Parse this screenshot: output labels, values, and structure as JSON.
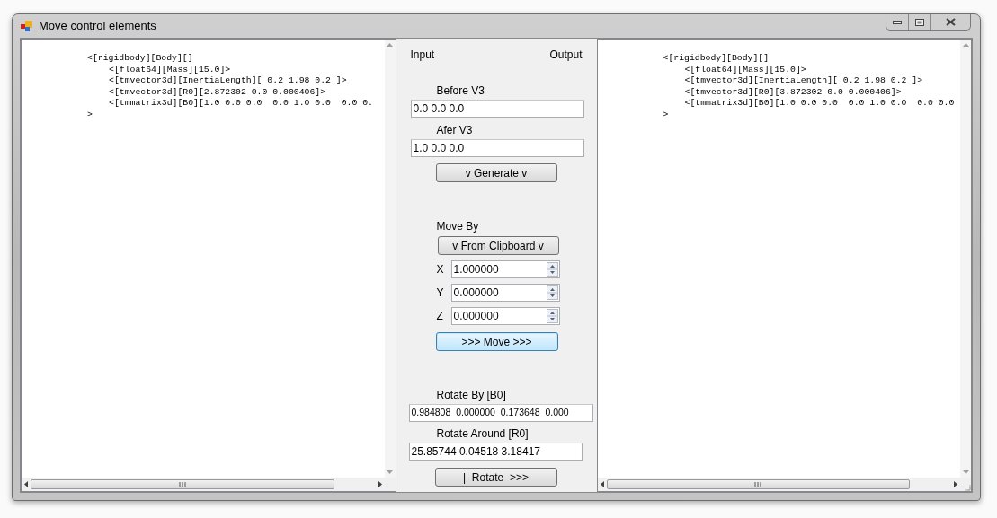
{
  "window": {
    "title": "Move control elements"
  },
  "input_pane": {
    "lines": [
      {
        "text": "<[rigidbody][Body][]",
        "children": [
          {
            "text": "<[float64][Mass][15.0]>"
          },
          {
            "text": "<[tmvector3d][InertiaLength][ 0.2 1.98 0.2 ]>"
          },
          {
            "text": "<[tmvector3d][R0][2.872302 0.0 0.000406]>"
          },
          {
            "text": "<[tmmatrix3d][B0][1.0 0.0 0.0  0.0 1.0 0.0  0.0 0."
          }
        ]
      },
      {
        "text": ">"
      }
    ]
  },
  "controls": {
    "input_label": "Input",
    "output_label": "Output",
    "before": {
      "label": "Before V3",
      "value": "0.0 0.0 0.0"
    },
    "after": {
      "label": "Afer V3",
      "value": "1.0 0.0 0.0"
    },
    "generate_button": "v Generate v",
    "move_by_label": "Move By",
    "clipboard_button": "v From Clipboard v",
    "axes": [
      {
        "label": "X",
        "value": "1.000000"
      },
      {
        "label": "Y",
        "value": "0.000000"
      },
      {
        "label": "Z",
        "value": "0.000000"
      }
    ],
    "move_button": {
      "label": ">>> Move >>>",
      "focused": true
    },
    "rotate_by": {
      "label": "Rotate By [B0]",
      "value": "0.984808  0.000000  0.173648  0.000"
    },
    "rotate_around": {
      "label": "Rotate Around [R0]",
      "value": "25.85744 0.04518 3.18417"
    },
    "rotate_button": "|  Rotate  >>>"
  },
  "output_pane": {
    "lines": [
      {
        "text": "<[rigidbody][Body][]",
        "children": [
          {
            "text": "<[float64][Mass][15.0]>"
          },
          {
            "text": "<[tmvector3d][InertiaLength][ 0.2 1.98 0.2 ]>"
          },
          {
            "text": "<[tmvector3d][R0][3.872302 0.0 0.000406]>"
          },
          {
            "text": "<[tmmatrix3d][B0][1.0 0.0 0.0  0.0 1.0 0.0  0.0 0.0"
          }
        ]
      },
      {
        "text": ">"
      }
    ]
  }
}
